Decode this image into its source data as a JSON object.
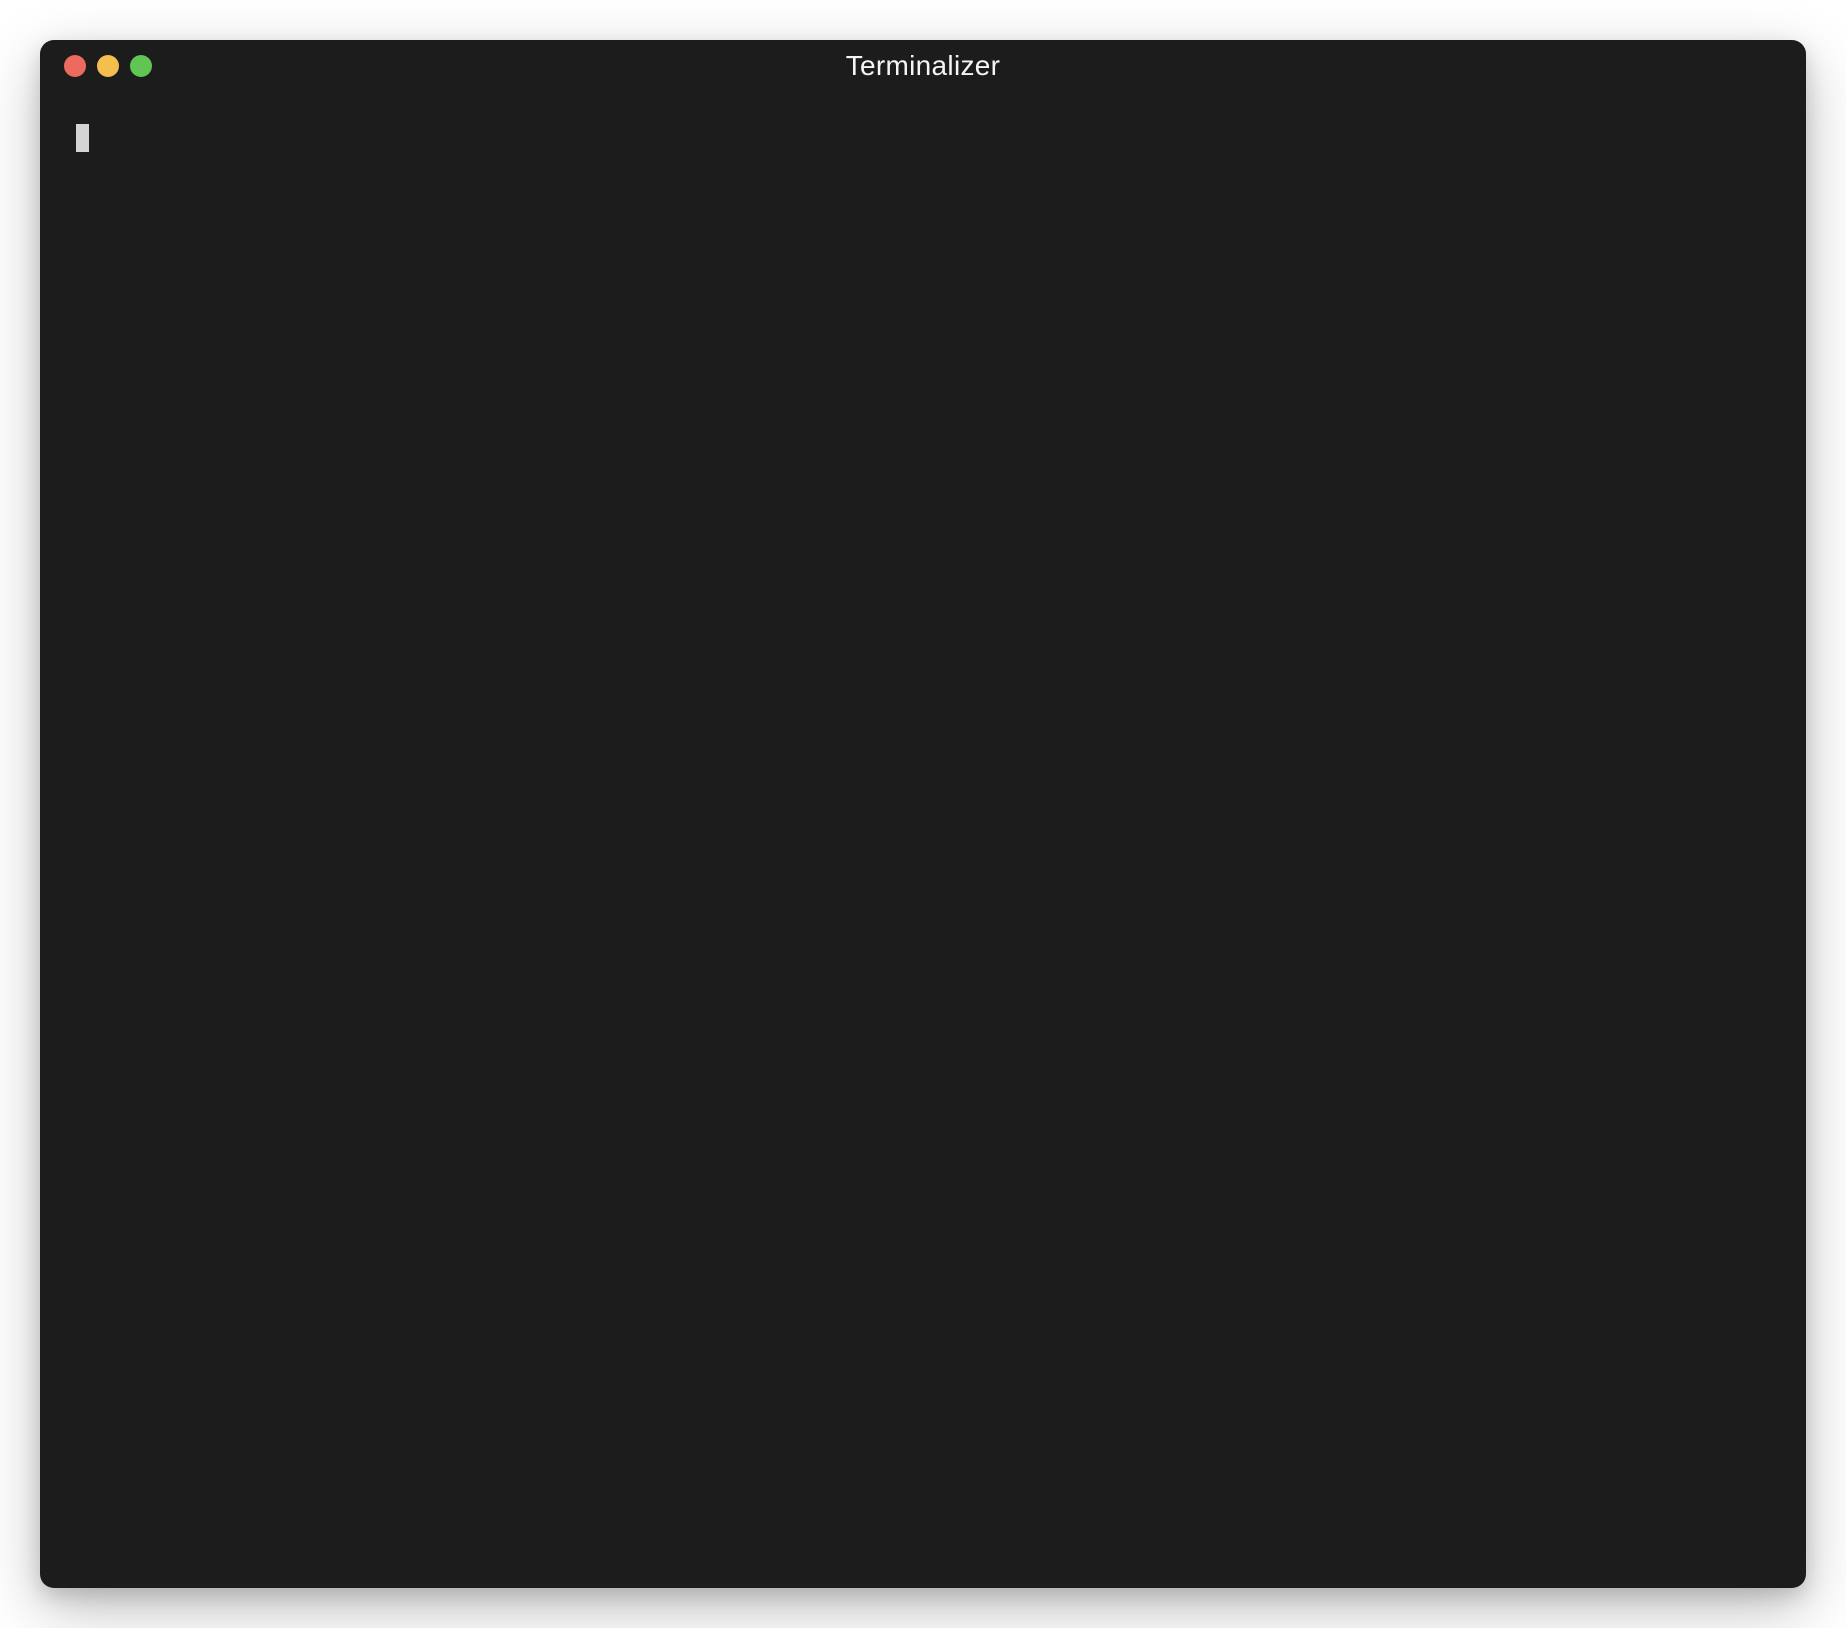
{
  "window": {
    "title": "Terminalizer"
  },
  "terminal": {
    "content": "",
    "cursor_visible": true
  },
  "colors": {
    "background": "#1c1c1c",
    "text": "#d4d4d4",
    "traffic_red": "#ed6a5e",
    "traffic_yellow": "#f5bf4f",
    "traffic_green": "#61c554"
  }
}
